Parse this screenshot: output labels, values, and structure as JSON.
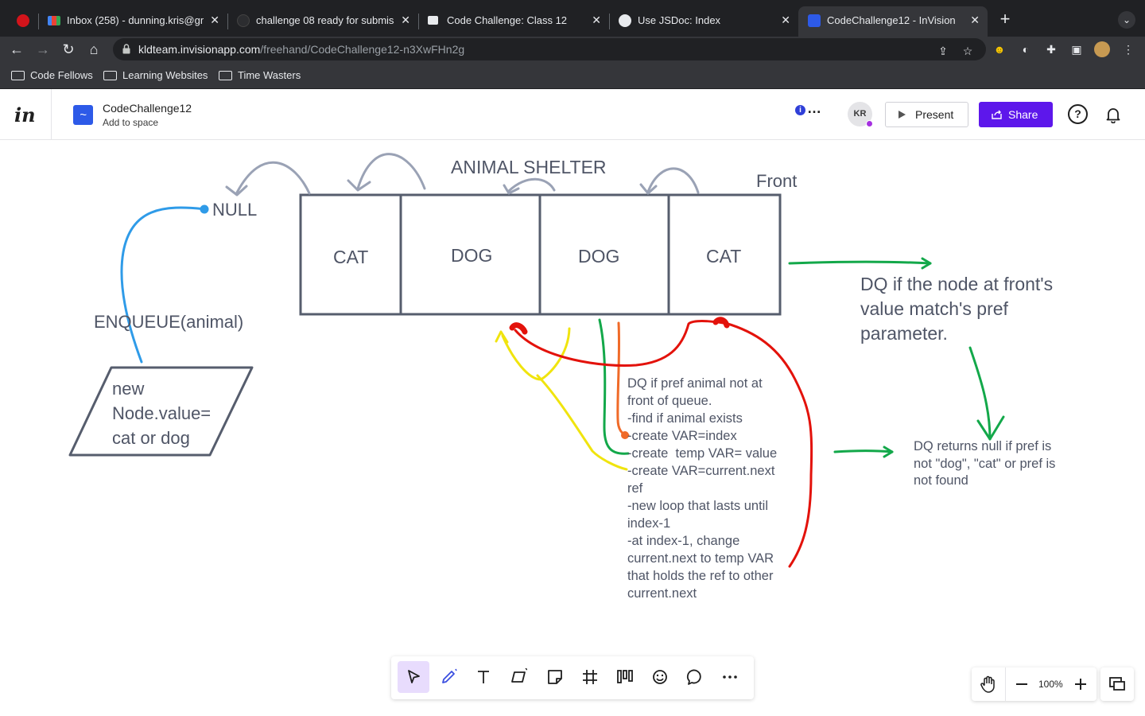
{
  "browser": {
    "tabs": [
      {
        "title": "",
        "favicon": "code-fellows-icon"
      },
      {
        "title": "Inbox (258) - dunning.kris@gm",
        "favicon": "gmail-icon"
      },
      {
        "title": "challenge 08 ready for submiss",
        "favicon": "github-icon"
      },
      {
        "title": "Code Challenge: Class 12",
        "favicon": "canvas-icon"
      },
      {
        "title": "Use JSDoc: Index",
        "favicon": "globe-icon"
      },
      {
        "title": "CodeChallenge12 - InVision",
        "favicon": "invision-icon",
        "active": true
      }
    ],
    "url_host": "kldteam.invisionapp.com",
    "url_path": "/freehand/CodeChallenge12-n3XwFHn2g",
    "bookmarks": [
      "Code Fellows",
      "Learning Websites",
      "Time Wasters"
    ]
  },
  "header": {
    "logo": "in",
    "doc_title": "CodeChallenge12",
    "space_link": "Add to space",
    "avatar_initials": "KR",
    "present_label": "Present",
    "share_label": "Share",
    "help_symbol": "?"
  },
  "canvas": {
    "title": "ANIMAL SHELTER",
    "front_label": "Front",
    "null_label": "NULL",
    "cells": [
      "CAT",
      "DOG",
      "DOG",
      "CAT"
    ],
    "enqueue_label": "ENQUEUE(animal)",
    "new_node_text": "new Node.value= cat or dog",
    "dq_front_text": "DQ if the node at front's value match's pref parameter.",
    "dq_pref_lines": [
      "DQ if pref animal not at",
      "front of queue.",
      "-find if animal exists",
      "-create VAR=index",
      "-create  temp VAR= value",
      "-create VAR=current.next",
      "ref",
      "-new loop that lasts until",
      "index-1",
      "-at index-1, change",
      "current.next to temp VAR",
      "that holds the ref to other",
      "current.next"
    ],
    "dq_null_text": "DQ returns null if pref is not \"dog\", \"cat\" or pref is not found",
    "ink_colors": {
      "gray": "#9aa2b5",
      "blue": "#2f9be8",
      "green": "#13a84a",
      "red": "#e3120b",
      "yellow": "#f0e40e",
      "orange": "#f06a28"
    }
  },
  "tools": [
    "select-tool",
    "pen-tool",
    "text-tool",
    "shape-tool",
    "sticky-note-tool",
    "frame-tool",
    "flowchart-tool",
    "sticker-tool",
    "comment-tool",
    "more-tool"
  ],
  "zoom": {
    "value": "100%"
  }
}
